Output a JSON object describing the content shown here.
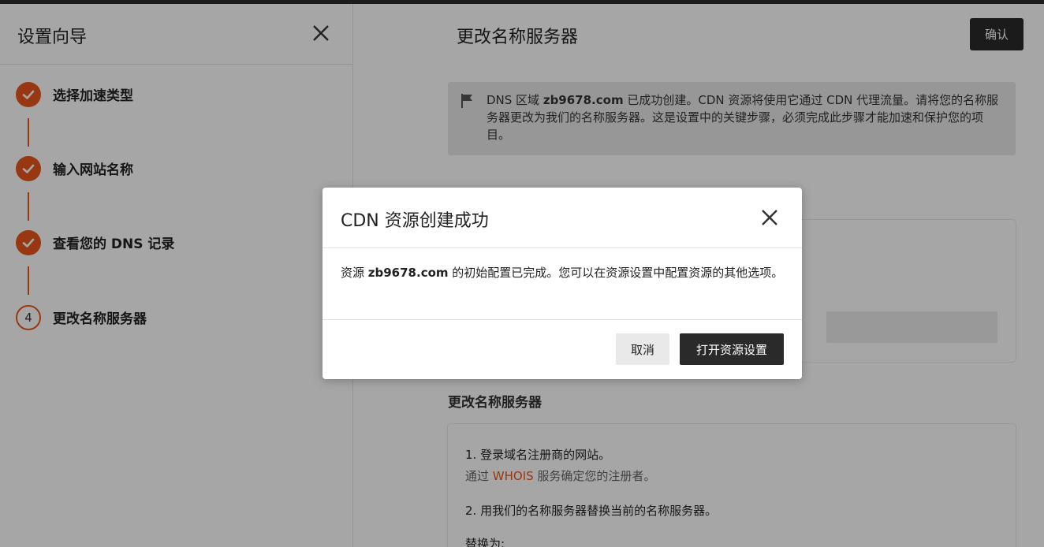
{
  "sidebar": {
    "title": "设置向导",
    "close_icon": "close-icon",
    "steps": [
      {
        "label": "选择加速类型",
        "state": "done"
      },
      {
        "label": "输入网站名称",
        "state": "done"
      },
      {
        "label": "查看您的 DNS 记录",
        "state": "done"
      },
      {
        "label": "更改名称服务器",
        "state": "current",
        "number": "4"
      }
    ]
  },
  "main": {
    "title": "更改名称服务器",
    "confirm_label": "确认",
    "info": {
      "prefix": "DNS 区域 ",
      "domain": "zb9678.com",
      "suffix": " 已成功创建。CDN 资源将使用它通过 CDN 代理流量。请将您的名称服务器更改为我们的名称服务器。这是设置中的关键步骤，必须完成此步骤才能加速和保护您的项目。"
    },
    "section_title": "更改名称服务器",
    "steps": {
      "step1": "1. 登录域名注册商的网站。",
      "step1_sub_prefix": "通过 ",
      "step1_sub_link": "WHOIS",
      "step1_sub_suffix": " 服务确定您的注册者。",
      "step2": "2. 用我们的名称服务器替换当前的名称服务器。",
      "replace_label": "替换为:"
    }
  },
  "dialog": {
    "title": "CDN 资源创建成功",
    "body_prefix": "资源 ",
    "body_domain": "zb9678.com",
    "body_suffix": " 的初始配置已完成。您可以在资源设置中配置资源的其他选项。",
    "cancel_label": "取消",
    "open_label": "打开资源设置"
  },
  "colors": {
    "accent": "#e8561c",
    "dark_button": "#2a2a2a"
  }
}
